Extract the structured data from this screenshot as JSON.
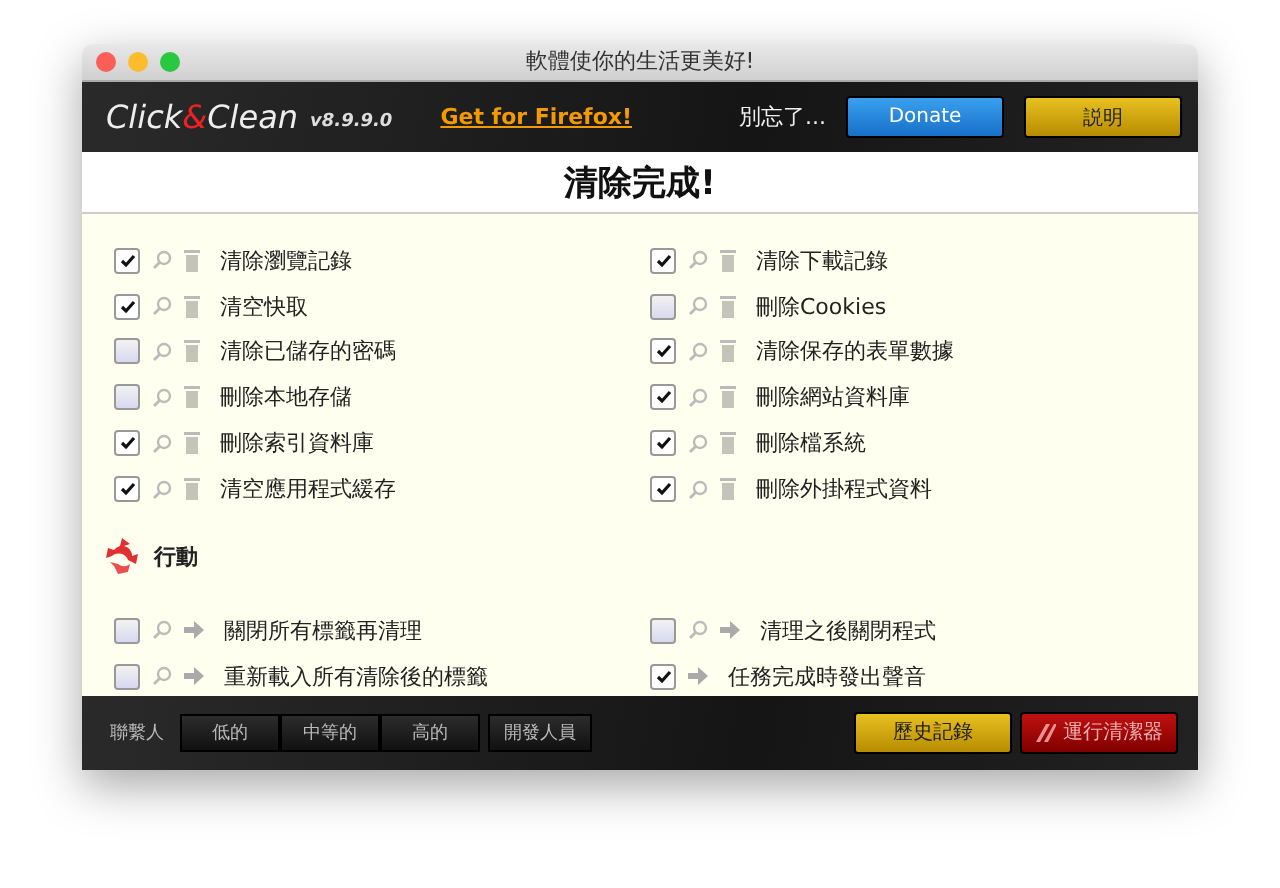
{
  "window": {
    "title": "軟體使你的生活更美好!"
  },
  "header": {
    "logo_left": "Click",
    "logo_amp": "&",
    "logo_right": "Clean",
    "version": "v8.9.9.0",
    "firefox_link": "Get for Firefox!",
    "reminder": "別忘了...",
    "donate_button": "Donate",
    "help_button": "説明"
  },
  "status_title": "清除完成!",
  "cleanup_items": [
    {
      "label": "清除瀏覽記錄",
      "checked": true
    },
    {
      "label": "清除下載記錄",
      "checked": true
    },
    {
      "label": "清空快取",
      "checked": true
    },
    {
      "label": "刪除Cookies",
      "checked": false
    },
    {
      "label": "清除已儲存的密碼",
      "checked": false
    },
    {
      "label": "清除保存的表單數據",
      "checked": true
    },
    {
      "label": "刪除本地存儲",
      "checked": false
    },
    {
      "label": "刪除網站資料庫",
      "checked": true
    },
    {
      "label": "刪除索引資料庫",
      "checked": true
    },
    {
      "label": "刪除檔系統",
      "checked": true
    },
    {
      "label": "清空應用程式緩存",
      "checked": true
    },
    {
      "label": "刪除外掛程式資料",
      "checked": true
    }
  ],
  "actions_section": {
    "title": "行動",
    "items": [
      {
        "label": "關閉所有標籤再清理",
        "checked": false,
        "preview": true
      },
      {
        "label": "清理之後關閉程式",
        "checked": false,
        "preview": true
      },
      {
        "label": "重新載入所有清除後的標籤",
        "checked": false,
        "preview": true
      },
      {
        "label": "任務完成時發出聲音",
        "checked": true,
        "preview": false
      }
    ]
  },
  "footer": {
    "contact_label": "聯繫人",
    "levels": [
      {
        "label": "低的",
        "selected": false
      },
      {
        "label": "中等的",
        "selected": false
      },
      {
        "label": "高的",
        "selected": false
      }
    ],
    "developer_button": "開發人員",
    "history_button": "歷史記錄",
    "run_button": "運行清潔器"
  }
}
